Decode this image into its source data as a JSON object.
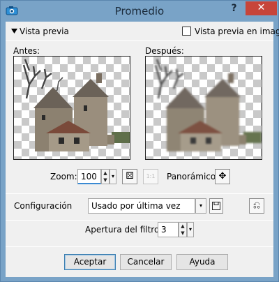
{
  "window": {
    "title": "Promedio"
  },
  "icons": {
    "app": "camera-icon",
    "help": "help-icon",
    "close": "close-icon",
    "collapse": "triangle-down-icon",
    "random": "dice-icon",
    "actual_size": "one-to-one-icon",
    "pan": "move-arrows-icon",
    "save_preset": "floppy-disk-icon",
    "reset": "reset-icon"
  },
  "preview": {
    "toggle_label": "Vista previa",
    "in_image_label": "Vista previa en imagen",
    "in_image_checked": false,
    "before_label": "Antes:",
    "after_label": "Después:"
  },
  "zoom": {
    "label": "Zoom:",
    "value": "100",
    "actual_size_glyph": "1:1",
    "panoramic_label": "Panorámico:"
  },
  "settings": {
    "label": "Configuración",
    "selected": "Usado por última vez"
  },
  "filter": {
    "label": "Apertura del filtro:",
    "value": "3"
  },
  "buttons": {
    "accept": "Aceptar",
    "cancel": "Cancelar",
    "help": "Ayuda"
  },
  "colors": {
    "title_bar": "#79a3c7",
    "close_button": "#c7453a",
    "dialog_bg": "#f0f0f0"
  }
}
